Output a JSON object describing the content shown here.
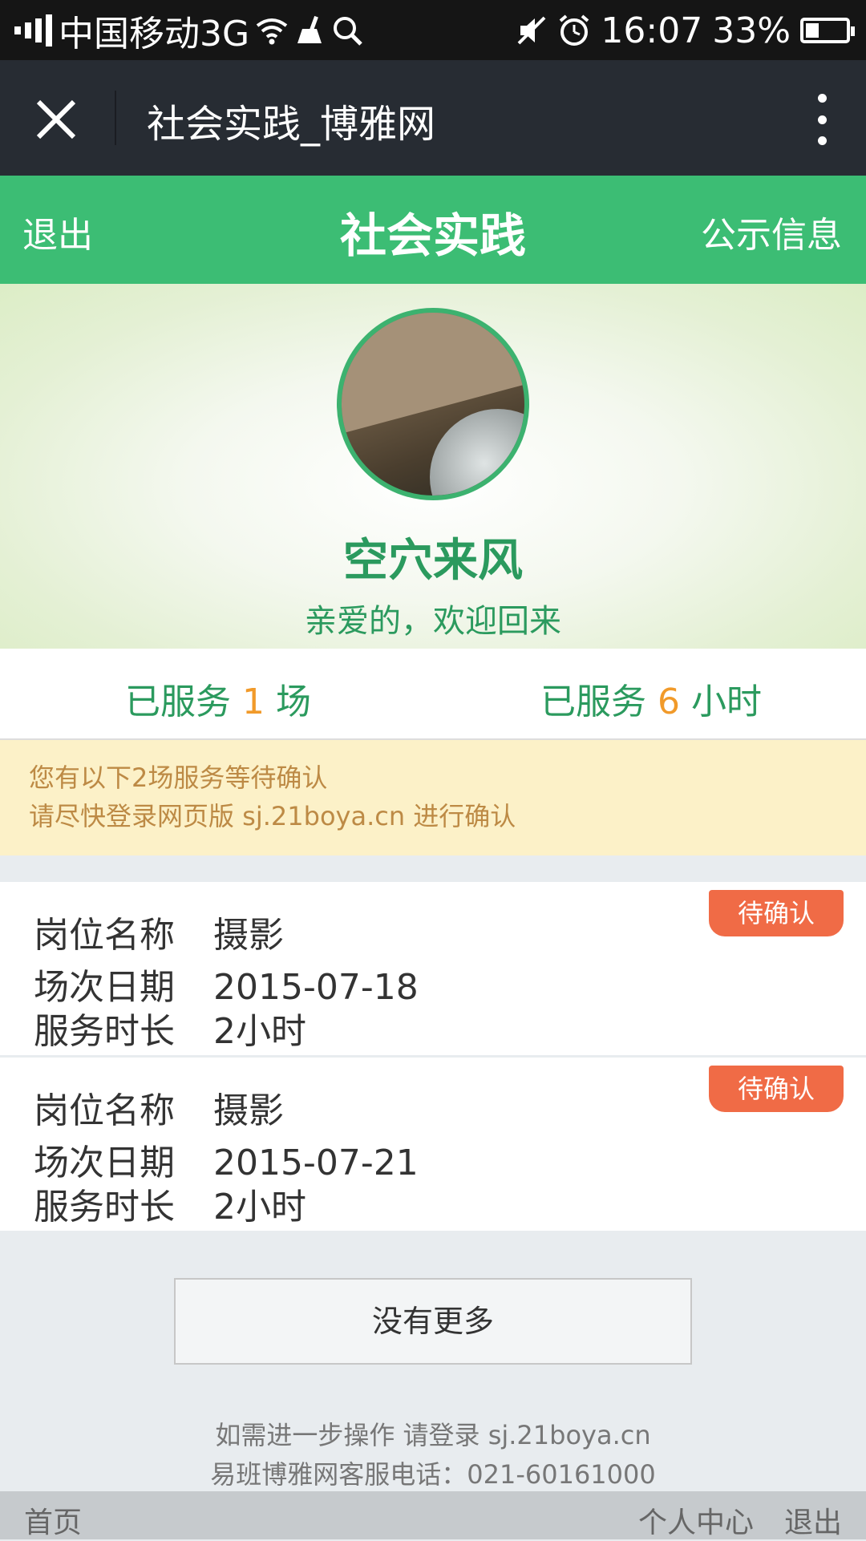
{
  "status_bar": {
    "carrier": "中国移动3G",
    "time": "16:07",
    "battery": "33%",
    "battery_level": 0.33
  },
  "title_bar": {
    "title": "社会实践_博雅网"
  },
  "nav": {
    "left": "退出",
    "title": "社会实践",
    "right": "公示信息"
  },
  "profile": {
    "name": "空穴来风",
    "welcome": "亲爱的，欢迎回来"
  },
  "stats": [
    {
      "prefix": "已服务 ",
      "value": "1",
      "suffix": " 场"
    },
    {
      "prefix": "已服务 ",
      "value": "6",
      "suffix": " 小时"
    }
  ],
  "notice": {
    "line1": "您有以下2场服务等待确认",
    "line2": "请尽快登录网页版 sj.21boya.cn 进行确认"
  },
  "records": [
    {
      "badge": "待确认",
      "rows": [
        {
          "label": "岗位名称",
          "value": "摄影"
        },
        {
          "label": "场次日期",
          "value": "2015-07-18"
        },
        {
          "label": "服务时长",
          "value": "2小时"
        }
      ]
    },
    {
      "badge": "待确认",
      "rows": [
        {
          "label": "岗位名称",
          "value": "摄影"
        },
        {
          "label": "场次日期",
          "value": "2015-07-21"
        },
        {
          "label": "服务时长",
          "value": "2小时"
        }
      ]
    }
  ],
  "no_more": "没有更多",
  "footer": {
    "line1": "如需进一步操作 请登录 sj.21boya.cn",
    "line2": "易班博雅网客服电话：021-60161000"
  },
  "bottom_nav": {
    "home": "首页",
    "personal": "个人中心",
    "exit": "退出"
  },
  "colors": {
    "green": "#3cbd74",
    "orange_badge": "#f06b46",
    "stat_number": "#f19a2a"
  },
  "icons": [
    "signal-icon",
    "wifi-icon",
    "clean-icon",
    "search-icon",
    "mute-icon",
    "alarm-icon",
    "battery-icon",
    "close-icon",
    "more-icon"
  ]
}
